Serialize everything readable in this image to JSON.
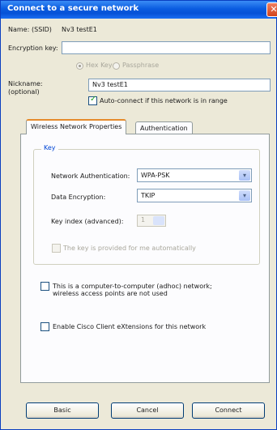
{
  "window": {
    "title": "Connect to a secure network"
  },
  "name_row": {
    "label": "Name:",
    "ssid_label": "(SSID)",
    "ssid_value": "Nv3 testE1"
  },
  "encryption_key": {
    "label": "Encryption key:",
    "value": ""
  },
  "key_format": {
    "hex": "Hex Key",
    "passphrase": "Passphrase"
  },
  "nickname": {
    "label": "Nickname:",
    "sublabel": "(optional)",
    "value": "Nv3 testE1"
  },
  "auto_connect": {
    "label": "Auto-connect if this network is in range",
    "checked": true
  },
  "tabs": [
    {
      "label": "Wireless Network Properties",
      "active": true
    },
    {
      "label": "Authentication",
      "active": false
    }
  ],
  "key_group": {
    "title": "Key",
    "network_auth_label": "Network Authentication:",
    "network_auth_value": "WPA-PSK",
    "data_enc_label": "Data Encryption:",
    "data_enc_value": "TKIP",
    "key_index_label": "Key index (advanced):",
    "key_index_value": "1",
    "auto_key_label": "The key is provided for me automatically"
  },
  "adhoc": {
    "label_line1": "This is a computer-to-computer (adhoc) network;",
    "label_line2": "wireless access points are not used"
  },
  "cisco": {
    "label": "Enable Cisco Client eXtensions for this network"
  },
  "buttons": {
    "basic": "Basic",
    "cancel": "Cancel",
    "connect": "Connect"
  },
  "colors": {
    "title_bar": "#0a5ce0",
    "dialog_bg": "#ece9d8",
    "group_title": "#0046d5",
    "tab_highlight": "#e68b2c"
  }
}
